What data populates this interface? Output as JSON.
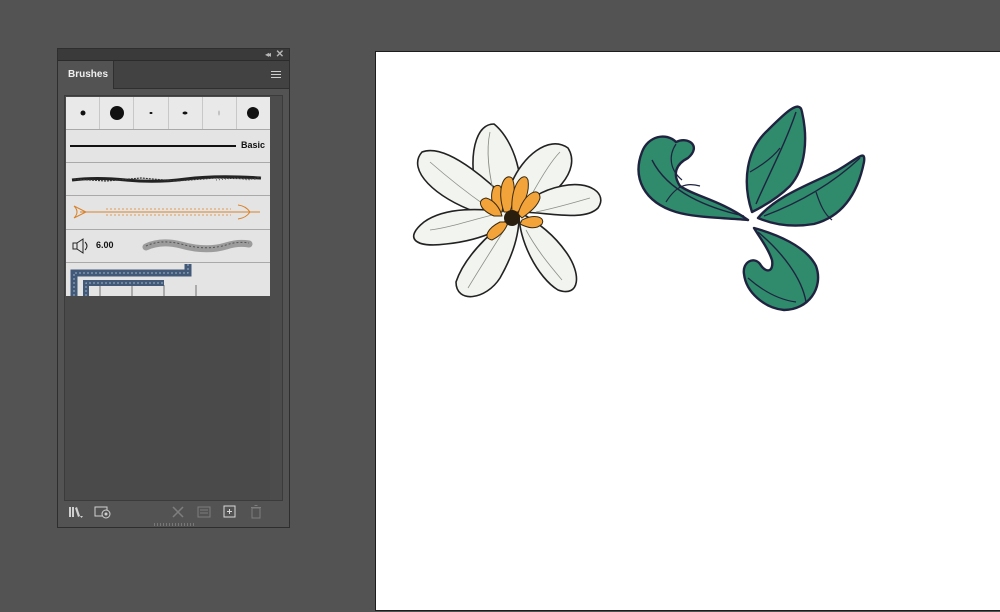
{
  "brushes_panel": {
    "collapse_glyph": "◂◂",
    "close_glyph": "✕",
    "tab_label": "Brushes",
    "menu_icon": "hamburger-icon",
    "basic_label": "Basic",
    "bristle_size": "6.00",
    "bottom_icons": [
      "brush-libraries-icon",
      "libraries-panel-icon",
      "remove-brush-stroke-icon",
      "brush-options-icon",
      "new-brush-icon",
      "delete-brush-icon"
    ]
  },
  "colors": {
    "workspace_bg": "#535353",
    "panel_bg": "#535353",
    "artboard_bg": "#ffffff",
    "leaf_fill": "#2f8b6c",
    "leaf_outline": "#1f2340",
    "petal_fill": "#f2f4ef",
    "stamen_fill": "#f2a33a",
    "brush_orange": "#d9822b"
  }
}
